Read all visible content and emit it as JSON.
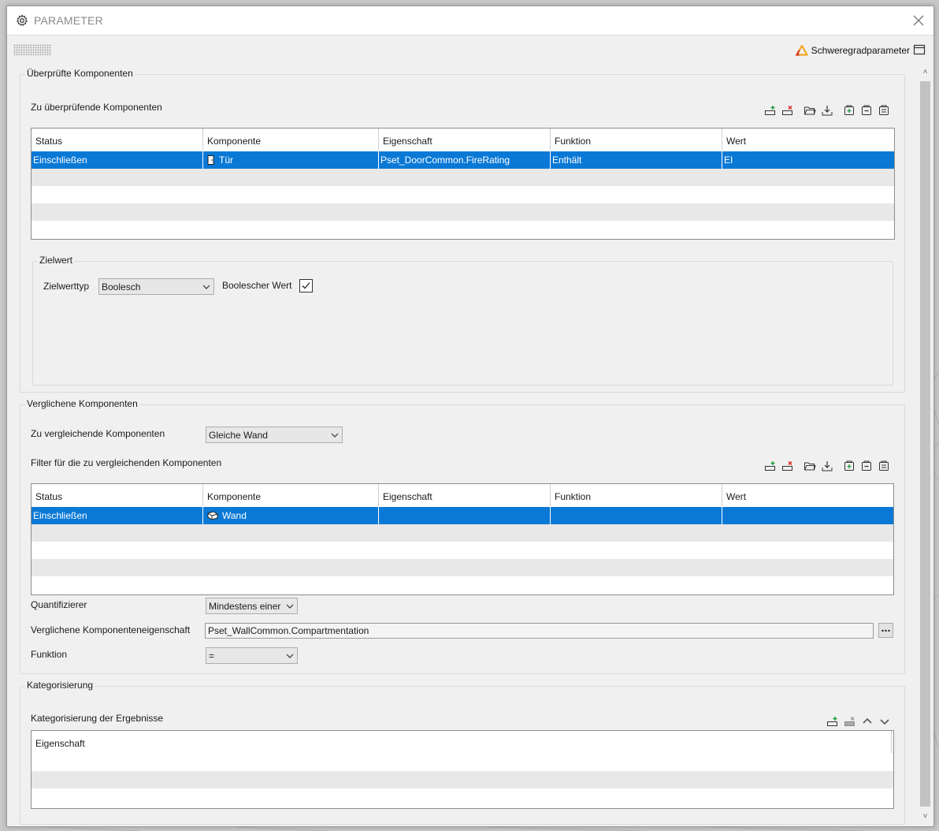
{
  "window": {
    "title": "PARAMETER",
    "severity_label": "Schweregradparameter"
  },
  "checked": {
    "group_title": "Überprüfte Komponenten",
    "grid_label": "Zu überprüfende Komponenten",
    "columns": [
      "Status",
      "Komponente",
      "Eigenschaft",
      "Funktion",
      "Wert"
    ],
    "rows": [
      {
        "status": "Einschließen",
        "component": "Tür",
        "component_icon": "door-icon",
        "property": "Pset_DoorCommon.FireRating",
        "function": "Enthält",
        "value": "EI"
      }
    ],
    "target": {
      "group_title": "Zielwert",
      "type_label": "Zielwerttyp",
      "type_value": "Boolesch",
      "bool_label": "Boolescher Wert",
      "bool_checked": true
    }
  },
  "compared": {
    "group_title": "Verglichene Komponenten",
    "compare_label": "Zu vergleichende Komponenten",
    "compare_value": "Gleiche Wand",
    "filter_label": "Filter für die zu vergleichenden Komponenten",
    "columns": [
      "Status",
      "Komponente",
      "Eigenschaft",
      "Funktion",
      "Wert"
    ],
    "rows": [
      {
        "status": "Einschließen",
        "component": "Wand",
        "component_icon": "wall-icon",
        "property": "",
        "function": "",
        "value": ""
      }
    ],
    "quantifier_label": "Quantifizierer",
    "quantifier_value": "Mindestens einer",
    "property_label": "Verglichene Komponenteneigenschaft",
    "property_value": "Pset_WallCommon.Compartmentation",
    "function_label": "Funktion",
    "function_value": "="
  },
  "categorization": {
    "group_title": "Kategorisierung",
    "grid_label": "Kategorisierung der Ergebnisse",
    "columns": [
      "Eigenschaft"
    ]
  },
  "colors": {
    "selection": "#0a79d6",
    "severity_icon": "#f5a623"
  }
}
